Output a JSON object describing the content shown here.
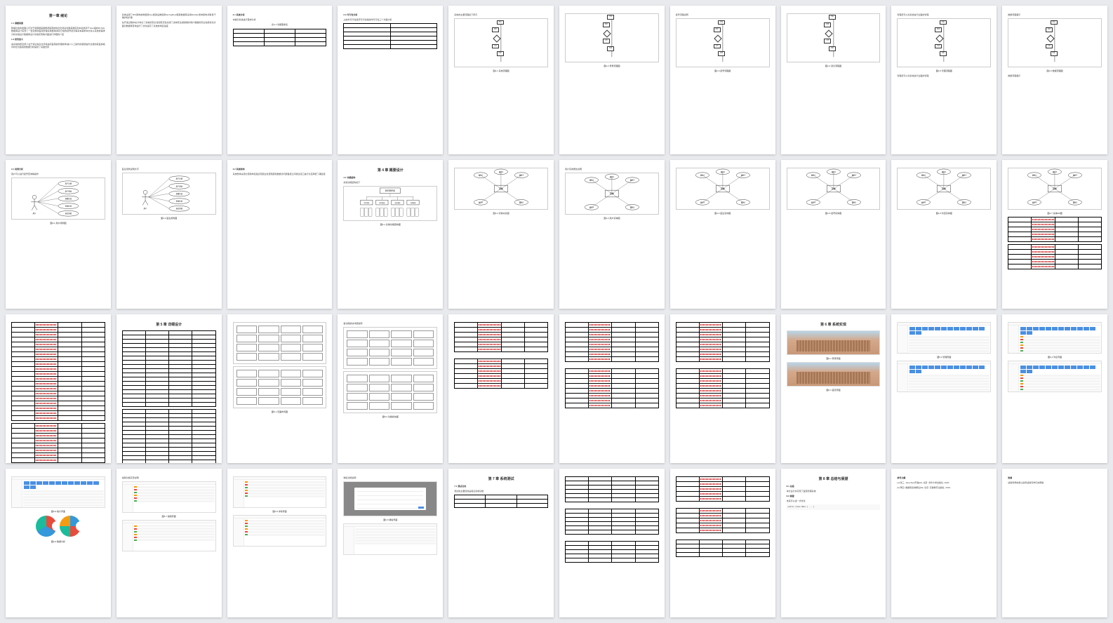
{
  "pages": [
    {
      "type": "text",
      "title": "第一章 绪论",
      "sections": [
        {
          "h": "1.1 课题背景",
          "p": "随着社会的发展人们对于健康越来越重视医院的信息化建设也越来越完善本系统基于Java语言MySQL数据库设计实现了一套完整的医院管理系统能够满足日常的挂号就诊等基本需求本文将从系统的需求分析系统设计数据库设计系统实现等方面进行详细的介绍"
        },
        {
          "h": "1.2 研究意义",
          "p": "本系统的研究意义在于通过信息化手段提高医院的管理效率减少人工操作的错误提升患者的就医体验同时也为医院的数据分析提供了基础支持"
        }
      ]
    },
    {
      "type": "text",
      "sections": [
        {
          "h": "",
          "p": "系统采用了B/S架构前端使用Vue框架后端使用SpringBoot框架数据库采用MySQL整体架构清晰易于维护和扩展"
        },
        {
          "h": "",
          "p": "在开发过程中充分考虑了系统的安全性和稳定性采用了多种安全措施保护用户数据的安全性能优化方面对数据库查询进行了优化提高了系统的响应速度"
        }
      ]
    },
    {
      "type": "text_table",
      "title": "",
      "sections": [
        {
          "h": "2.1 系统分析",
          "p": "本章对系统进行需求分析"
        }
      ],
      "table_title": "表2-1 功能需求表",
      "table": {
        "rows": 4,
        "cols": 3
      }
    },
    {
      "type": "text_table",
      "sections": [
        {
          "h": "2.2 可行性分析",
          "p": "从技术可行性经济可行性和操作可行性三个方面分析"
        }
      ],
      "table": {
        "rows": 6,
        "cols": 2
      }
    },
    {
      "type": "flowchart",
      "title": "",
      "caption": "图2-1 系统流程图",
      "sections": [
        {
          "p": "系统的主要流程如下所示"
        }
      ]
    },
    {
      "type": "flowchart",
      "caption": "图2-2 登录流程图"
    },
    {
      "type": "flowchart",
      "caption": "图2-3 挂号流程图",
      "sections": [
        {
          "p": "挂号流程说明"
        }
      ]
    },
    {
      "type": "flowchart",
      "caption": "图2-4 就诊流程图"
    },
    {
      "type": "flowchart_text",
      "caption": "图2-5 管理流程图",
      "sections": [
        {
          "p": "管理员可以对系统进行全面的管理"
        }
      ]
    },
    {
      "type": "flowchart_text",
      "caption": "图2-6 数据流程图",
      "sections": [
        {
          "p": "数据流程展示"
        }
      ]
    },
    {
      "type": "usecase",
      "caption": "图3-1 用户用例图",
      "sections": [
        {
          "h": "3.1 用例分析",
          "p": "用户可以进行挂号查询等操作"
        }
      ]
    },
    {
      "type": "usecase",
      "caption": "图3-2 医生用例图",
      "sections": [
        {
          "p": "医生用例说明文字"
        }
      ]
    },
    {
      "type": "text",
      "sections": [
        {
          "h": "3.2 系统架构",
          "p": "系统整体采用分层架构包括表现层业务逻辑层和数据访问层各层之间通过接口进行交互降低了耦合度"
        }
      ]
    },
    {
      "type": "hierarchy",
      "title": "第 4 章 概要设计",
      "caption": "图4-1 系统功能结构图",
      "sections": [
        {
          "h": "4.1 功能结构",
          "p": "系统功能结构如下"
        }
      ]
    },
    {
      "type": "er",
      "caption": "图4-2 实体关系图"
    },
    {
      "type": "er",
      "caption": "图4-3 用户实体图",
      "sections": [
        {
          "p": "用户实体属性说明"
        }
      ]
    },
    {
      "type": "er",
      "caption": "图4-4 医生实体图"
    },
    {
      "type": "er",
      "caption": "图4-5 挂号实体图"
    },
    {
      "type": "er",
      "caption": "图4-6 科室实体图"
    },
    {
      "type": "er_table",
      "caption": "图4-7 总体ER图",
      "table": {
        "rows": 5,
        "cols": 4,
        "red": true
      }
    },
    {
      "type": "bigtable",
      "table": {
        "rows": 20,
        "cols": 4,
        "red": true
      }
    },
    {
      "type": "bigtable",
      "title": "第 5 章 详细设计",
      "table": {
        "rows": 18,
        "cols": 4
      }
    },
    {
      "type": "wireframe",
      "caption": "图5-1 页面布局图"
    },
    {
      "type": "wireframe",
      "caption": "图5-2 功能模块图",
      "sections": [
        {
          "p": "各功能模块详细说明"
        }
      ]
    },
    {
      "type": "tables_multi",
      "tables": [
        {
          "rows": 6,
          "cols": 4,
          "red": true
        },
        {
          "rows": 6,
          "cols": 4,
          "red": true
        }
      ]
    },
    {
      "type": "tables_multi",
      "tables": [
        {
          "rows": 8,
          "cols": 4,
          "red": true
        },
        {
          "rows": 8,
          "cols": 4,
          "red": true
        }
      ]
    },
    {
      "type": "tables_multi",
      "tables": [
        {
          "rows": 8,
          "cols": 4,
          "red": true
        },
        {
          "rows": 8,
          "cols": 4,
          "red": true
        }
      ]
    },
    {
      "type": "screenshot_building",
      "title": "第 6 章 系统实现",
      "caption": "图6-1 登录界面",
      "caption2": "图6-2 首页界面"
    },
    {
      "type": "screenshot_ui",
      "caption": "图6-3 管理界面",
      "has_cal": true
    },
    {
      "type": "screenshot_ui",
      "caption": "图6-4 列表界面",
      "has_cal": true,
      "has_btns": true
    },
    {
      "type": "screenshot_donut",
      "caption": "图6-5 统计界面",
      "caption2": "图6-6 数据分析"
    },
    {
      "type": "screenshot_ui",
      "caption": "图6-7 编辑界面",
      "has_btns": true,
      "sections": [
        {
          "p": "编辑功能实现说明"
        }
      ]
    },
    {
      "type": "screenshot_ui",
      "caption": "图6-8 详情界面",
      "has_btns": true
    },
    {
      "type": "screenshot_modal",
      "caption": "图6-9 弹窗界面",
      "sections": [
        {
          "p": "弹窗功能说明"
        }
      ]
    },
    {
      "type": "text_table",
      "title": "第 7 章 系统测试",
      "sections": [
        {
          "h": "7.1 测试目的",
          "p": "测试的主要目的是验证系统功能"
        }
      ],
      "table": {
        "rows": 3,
        "cols": 3
      }
    },
    {
      "type": "tables_multi",
      "tables": [
        {
          "rows": 6,
          "cols": 4
        },
        {
          "rows": 6,
          "cols": 4
        },
        {
          "rows": 5,
          "cols": 4
        }
      ]
    },
    {
      "type": "tables_multi",
      "tables": [
        {
          "rows": 5,
          "cols": 4,
          "red": true
        },
        {
          "rows": 5,
          "cols": 4,
          "red": true
        },
        {
          "rows": 4,
          "cols": 4
        }
      ]
    },
    {
      "type": "text_code",
      "title": "第 8 章 总结与展望",
      "sections": [
        {
          "h": "8.1 总结",
          "p": "本文设计并实现了医院管理系统"
        },
        {
          "h": "8.2 展望",
          "p": "未来可以进一步优化"
        }
      ]
    },
    {
      "type": "text",
      "sections": [
        {
          "h": "参考文献",
          "p": "[1] 张三. Java Web开发[M]. 北京: 清华大学出版社, 2020."
        },
        {
          "h": "",
          "p": "[2] 李四. 数据库系统概论[M]. 北京: 高等教育出版社, 2019."
        }
      ]
    },
    {
      "type": "text",
      "sections": [
        {
          "h": "致谢",
          "p": "感谢导师的悉心指导感谢同学们的帮助"
        }
      ]
    }
  ],
  "flowchart_labels": [
    "开始",
    "登录",
    "验证",
    "主页",
    "结束"
  ],
  "er_center": "实体",
  "er_attrs": [
    "属性1",
    "属性2",
    "属性3",
    "属性4",
    "属性5"
  ],
  "usecase_actor": "用户",
  "usecase_cases": [
    "用户注册",
    "用户登录",
    "查看信息",
    "修改信息",
    "退出系统"
  ],
  "hier_root": "医院管理系统",
  "hier_children": [
    "用户管理",
    "医生管理",
    "挂号管理",
    "药品管理"
  ]
}
